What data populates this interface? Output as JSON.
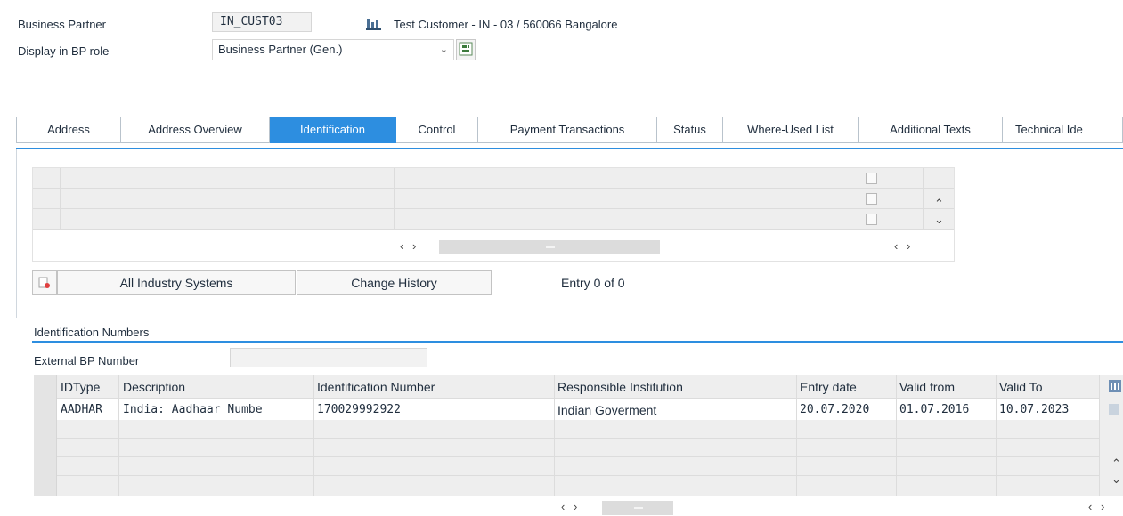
{
  "header": {
    "bp_label": "Business Partner",
    "bp_value": "IN_CUST03",
    "bp_description": "Test Customer - IN - 03 / 560066 Bangalore",
    "role_label": "Display in BP role",
    "role_value": "Business Partner (Gen.)"
  },
  "tabs": [
    {
      "label": "Address",
      "active": false
    },
    {
      "label": "Address Overview",
      "active": false
    },
    {
      "label": "Identification",
      "active": true
    },
    {
      "label": "Control",
      "active": false
    },
    {
      "label": "Payment Transactions",
      "active": false
    },
    {
      "label": "Status",
      "active": false
    },
    {
      "label": "Where-Used List",
      "active": false
    },
    {
      "label": "Additional Texts",
      "active": false
    },
    {
      "label": "Technical Ide",
      "active": false
    }
  ],
  "industry_panel": {
    "all_industry_button": "All Industry Systems",
    "change_history_button": "Change History",
    "entry_count": "Entry 0 of 0"
  },
  "identification": {
    "section_title": "Identification Numbers",
    "external_bp_label": "External BP Number",
    "external_bp_value": "",
    "columns": [
      "IDType",
      "Description",
      "Identification Number",
      "Responsible Institution",
      "Entry date",
      "Valid from",
      "Valid To"
    ],
    "rows": [
      {
        "idtype": "AADHAR",
        "description": "India: Aadhaar Numbe",
        "id_number": "170029992922",
        "institution": "Indian Goverment",
        "entry_date": "20.07.2020",
        "valid_from": "01.07.2016",
        "valid_to": "10.07.2023"
      }
    ]
  },
  "icons": {
    "bp_icon": "business-partner-icon",
    "role_icon": "switch-role-icon",
    "delete_icon": "delete-row-icon",
    "table_settings_icon": "table-settings-icon"
  },
  "colors": {
    "accent": "#2d8ee0",
    "grid": "#eeeeee"
  }
}
